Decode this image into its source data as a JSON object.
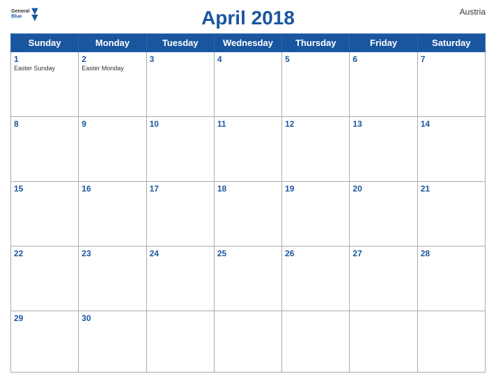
{
  "header": {
    "title": "April 2018",
    "country": "Austria",
    "logo": {
      "line1": "General",
      "line2": "Blue"
    }
  },
  "calendar": {
    "days_of_week": [
      "Sunday",
      "Monday",
      "Tuesday",
      "Wednesday",
      "Thursday",
      "Friday",
      "Saturday"
    ],
    "weeks": [
      [
        {
          "date": "1",
          "holiday": "Easter Sunday",
          "weekend": true
        },
        {
          "date": "2",
          "holiday": "Easter Monday",
          "weekend": false
        },
        {
          "date": "3",
          "holiday": "",
          "weekend": false
        },
        {
          "date": "4",
          "holiday": "",
          "weekend": false
        },
        {
          "date": "5",
          "holiday": "",
          "weekend": false
        },
        {
          "date": "6",
          "holiday": "",
          "weekend": false
        },
        {
          "date": "7",
          "holiday": "",
          "weekend": true
        }
      ],
      [
        {
          "date": "8",
          "holiday": "",
          "weekend": true
        },
        {
          "date": "9",
          "holiday": "",
          "weekend": false
        },
        {
          "date": "10",
          "holiday": "",
          "weekend": false
        },
        {
          "date": "11",
          "holiday": "",
          "weekend": false
        },
        {
          "date": "12",
          "holiday": "",
          "weekend": false
        },
        {
          "date": "13",
          "holiday": "",
          "weekend": false
        },
        {
          "date": "14",
          "holiday": "",
          "weekend": true
        }
      ],
      [
        {
          "date": "15",
          "holiday": "",
          "weekend": true
        },
        {
          "date": "16",
          "holiday": "",
          "weekend": false
        },
        {
          "date": "17",
          "holiday": "",
          "weekend": false
        },
        {
          "date": "18",
          "holiday": "",
          "weekend": false
        },
        {
          "date": "19",
          "holiday": "",
          "weekend": false
        },
        {
          "date": "20",
          "holiday": "",
          "weekend": false
        },
        {
          "date": "21",
          "holiday": "",
          "weekend": true
        }
      ],
      [
        {
          "date": "22",
          "holiday": "",
          "weekend": true
        },
        {
          "date": "23",
          "holiday": "",
          "weekend": false
        },
        {
          "date": "24",
          "holiday": "",
          "weekend": false
        },
        {
          "date": "25",
          "holiday": "",
          "weekend": false
        },
        {
          "date": "26",
          "holiday": "",
          "weekend": false
        },
        {
          "date": "27",
          "holiday": "",
          "weekend": false
        },
        {
          "date": "28",
          "holiday": "",
          "weekend": true
        }
      ],
      [
        {
          "date": "29",
          "holiday": "",
          "weekend": true
        },
        {
          "date": "30",
          "holiday": "",
          "weekend": false
        },
        {
          "date": "",
          "holiday": "",
          "weekend": false
        },
        {
          "date": "",
          "holiday": "",
          "weekend": false
        },
        {
          "date": "",
          "holiday": "",
          "weekend": false
        },
        {
          "date": "",
          "holiday": "",
          "weekend": false
        },
        {
          "date": "",
          "holiday": "",
          "weekend": true
        }
      ]
    ]
  }
}
